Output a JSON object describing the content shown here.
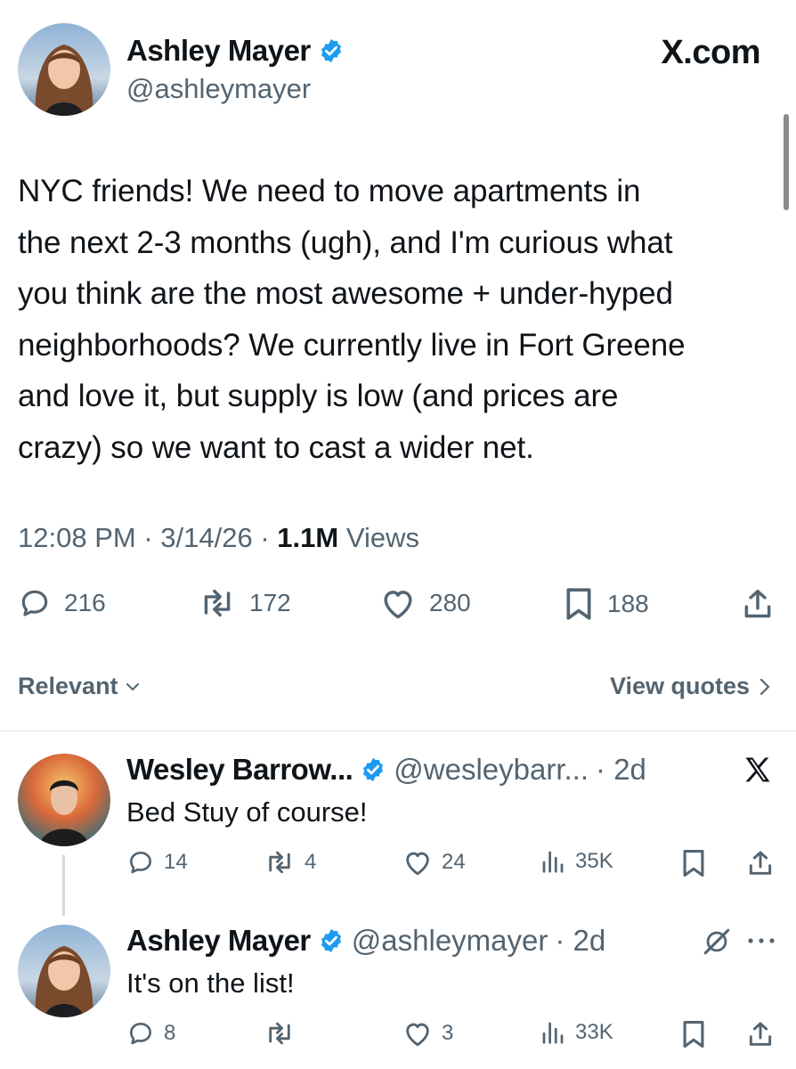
{
  "main_tweet": {
    "author": {
      "name": "Ashley Mayer",
      "handle": "@ashleymayer",
      "verified_color": "#1d9bf0"
    },
    "brand": "X.com",
    "text_lines": [
      "NYC friends! We need to move apartments in",
      "the next 2-3 months (ugh), and I'm curious what",
      "you think are the most awesome + under-hyped",
      "neighborhoods? We currently live in Fort Greene",
      "and love it, but supply is low (and prices are",
      "crazy) so we want to cast a wider net."
    ],
    "meta": {
      "time": "12:08 PM",
      "sep1": "·",
      "date": "3/14/26",
      "sep2": "·",
      "views_count": "1.1M",
      "views_label": "Views"
    },
    "actions": {
      "replies": "216",
      "reposts": "172",
      "likes": "280",
      "bookmarks": "188"
    }
  },
  "sort": {
    "label": "Relevant",
    "view_quotes": "View quotes"
  },
  "replies": [
    {
      "name": "Wesley Barrow...",
      "handle": "@wesleybarr...",
      "age": "· 2d",
      "text": "Bed Stuy of course!",
      "replies": "14",
      "reposts": "4",
      "likes": "24",
      "views": "35K"
    },
    {
      "name": "Ashley Mayer",
      "handle": "@ashleymayer",
      "age": "· 2d",
      "text": "It's on the list!",
      "replies": "8",
      "reposts": "",
      "likes": "3",
      "views": "33K"
    }
  ],
  "icons": [
    "verified-badge-icon",
    "x-logo-icon",
    "reply-icon",
    "repost-icon",
    "like-icon",
    "bookmark-icon",
    "share-icon",
    "views-icon",
    "chevron-down-icon",
    "chevron-right-icon",
    "grok-icon",
    "more-icon"
  ],
  "colors": {
    "text": "#0f1419",
    "secondary": "#536471",
    "verified": "#1d9bf0",
    "divider": "#e1e6ea"
  }
}
